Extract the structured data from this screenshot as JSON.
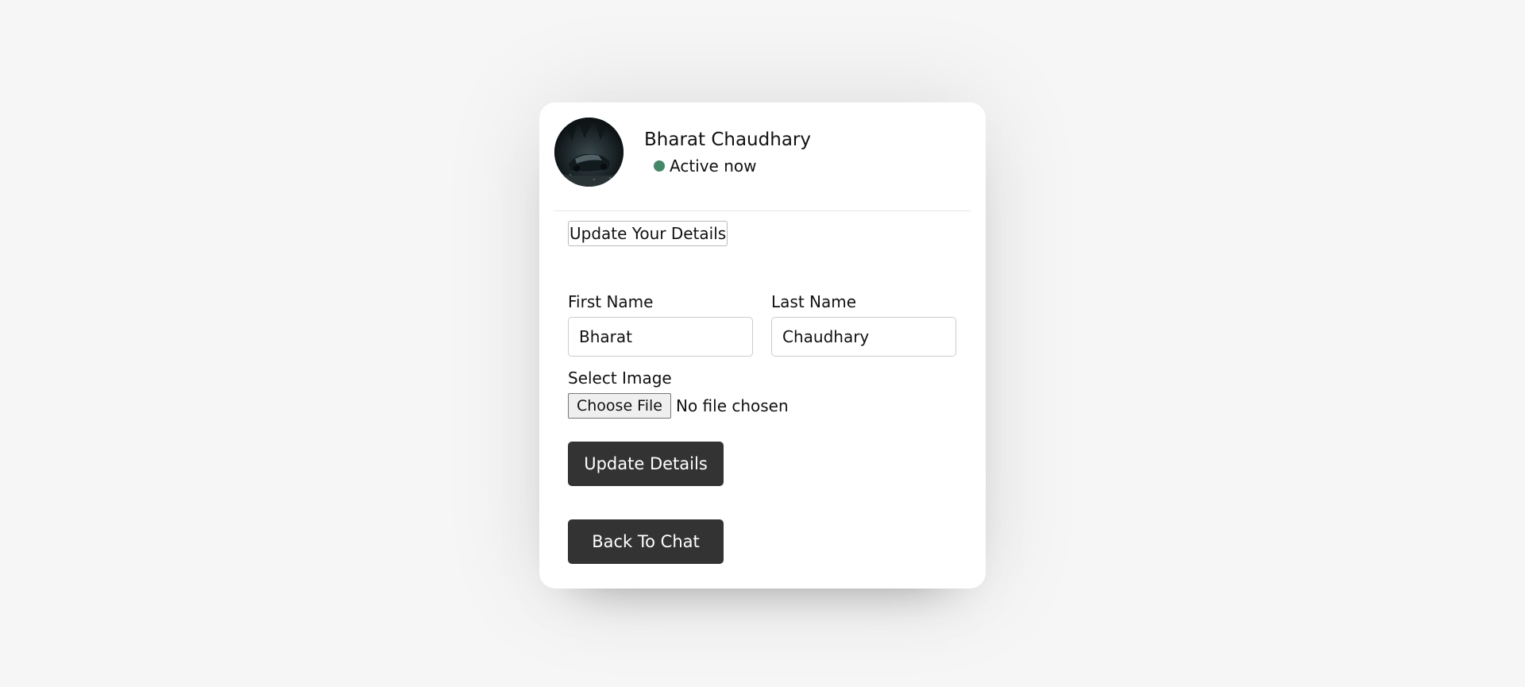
{
  "profile": {
    "name": "Bharat Chaudhary",
    "status": "Active now",
    "status_color": "#468669",
    "avatar_icon": "avatar-photo"
  },
  "form": {
    "title": "Update Your Details",
    "first_name_label": "First Name",
    "first_name_value": "Bharat",
    "last_name_label": "Last Name",
    "last_name_value": "Chaudhary",
    "image_label": "Select Image",
    "choose_file_label": "Choose File",
    "file_status": "No file chosen",
    "submit_label": "Update Details"
  },
  "navigation": {
    "back_label": "Back To Chat"
  },
  "colors": {
    "page_background": "#f6f6f6",
    "card_background": "#ffffff",
    "button_background": "#333333"
  }
}
